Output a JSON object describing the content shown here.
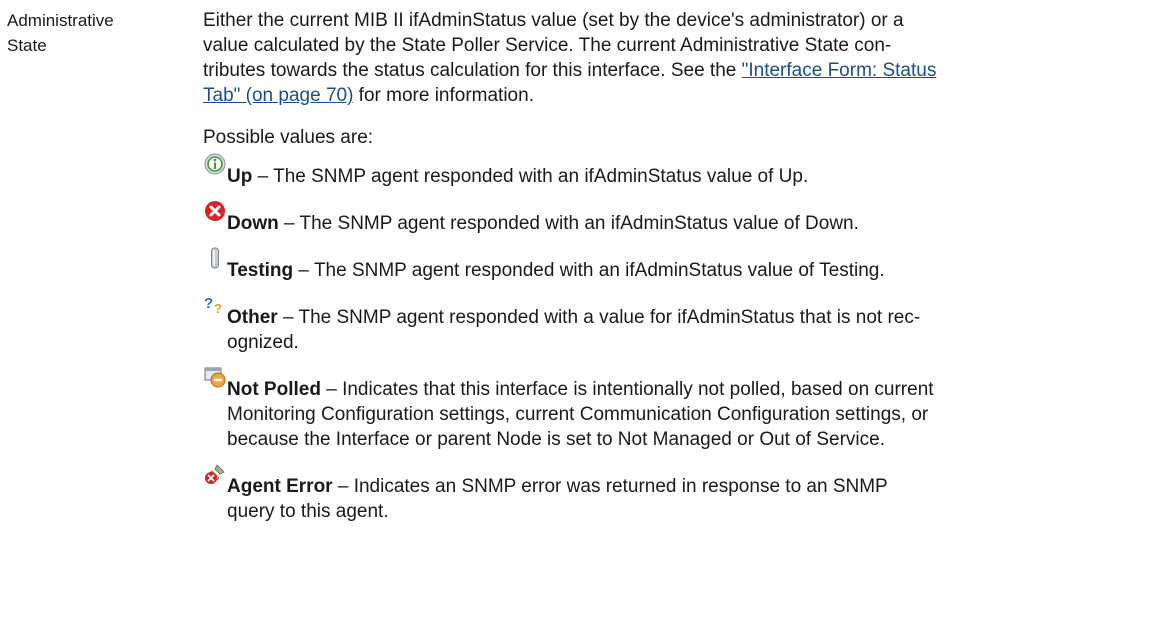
{
  "term": {
    "line1": "Administrative",
    "line2": "State"
  },
  "description": {
    "line1": "Either the current MIB II ifAdminStatus value (set by the device's administrator) or a",
    "line2": "value calculated by the State Poller Service. The current Administrative State con-",
    "line3_before_link": "tributes towards the status calculation for this interface. See the ",
    "link_part1": "\"Interface Form: Status",
    "link_part2": "Tab\" (on page 70)",
    "line4_after_link": " for more information."
  },
  "possible_values_label": "Possible values are:",
  "values": [
    {
      "icon": "info-up-icon",
      "name": "Up",
      "line1": " – The SNMP agent responded with an ifAdminStatus value of Up."
    },
    {
      "icon": "red-x-down-icon",
      "name": "Down",
      "line1": " – The SNMP agent responded with an ifAdminStatus value of Down."
    },
    {
      "icon": "testing-tube-icon",
      "name": "Testing",
      "line1": " – The SNMP agent responded with an ifAdminStatus value of Testing."
    },
    {
      "icon": "question-marks-icon",
      "name": "Other",
      "line1": " – The SNMP agent responded with a value for ifAdminStatus that is not rec-",
      "line2": "ognized."
    },
    {
      "icon": "not-polled-icon",
      "name": "Not Polled",
      "line1": " – Indicates that this interface is intentionally not polled, based on current",
      "line2": "Monitoring Configuration settings, current Communication Configuration settings, or",
      "line3": "because the Interface or parent Node is set to Not Managed or Out of Service."
    },
    {
      "icon": "agent-error-icon",
      "name": "Agent Error",
      "line1": " – Indicates an SNMP error was returned in response to an SNMP",
      "line2": "query to this agent."
    }
  ],
  "colors": {
    "link": "#1a4f8b",
    "text": "#1a1a1a",
    "down_red": "#d8232a",
    "up_green": "#3f9b3a"
  }
}
